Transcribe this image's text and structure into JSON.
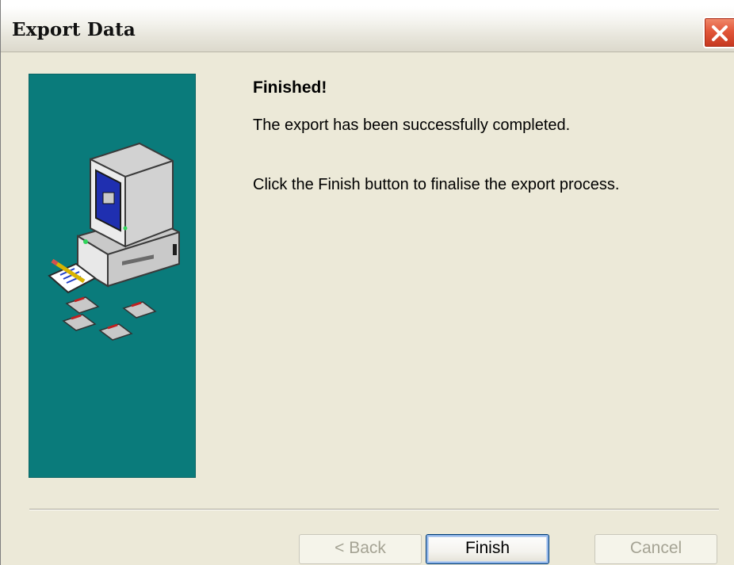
{
  "window": {
    "title": "Export Data"
  },
  "content": {
    "heading": "Finished!",
    "message": "The export has been successfully completed.",
    "instruction": "Click the Finish button to finalise the export process."
  },
  "buttons": {
    "back_label": "< Back",
    "finish_label": "Finish",
    "cancel_label": "Cancel"
  },
  "state": {
    "back_enabled": false,
    "finish_enabled": true,
    "cancel_enabled": false
  },
  "icons": {
    "close": "close-icon",
    "illustration": "computer-floppy-illustration"
  },
  "colors": {
    "side_panel": "#0a7b7b",
    "close_button": "#e2573a",
    "dialog_background": "#ece9d8",
    "finish_focus": "#003c74"
  }
}
